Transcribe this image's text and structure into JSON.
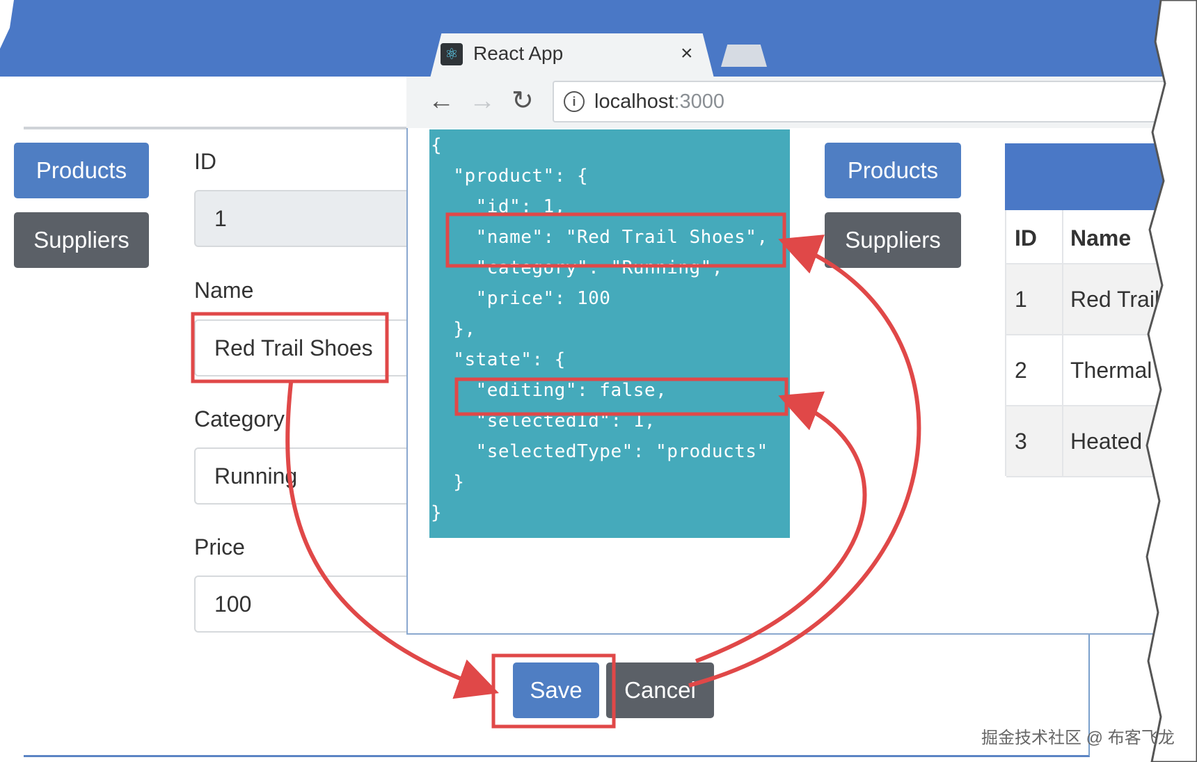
{
  "browser": {
    "tab_title": "React App",
    "tab_close": "×",
    "url_host": "localhost",
    "url_port": ":3000",
    "nav": {
      "back": "←",
      "forward": "→",
      "reload": "↻",
      "info": "i"
    },
    "react_icon": "⚛"
  },
  "left_app": {
    "products_button": "Products",
    "suppliers_button": "Suppliers",
    "form": {
      "id_label": "ID",
      "id_value": "1",
      "name_label": "Name",
      "name_value": "Red Trail Shoes",
      "category_label": "Category",
      "category_value": "Running",
      "price_label": "Price",
      "price_value": "100"
    },
    "save_button": "Save",
    "cancel_button": "Cancel"
  },
  "right_app": {
    "products_button": "Products",
    "suppliers_button": "Suppliers",
    "table": {
      "headers": [
        "ID",
        "Name"
      ],
      "rows": [
        {
          "id": "1",
          "name": "Red Trail"
        },
        {
          "id": "2",
          "name": "Thermal H"
        },
        {
          "id": "3",
          "name": "Heated Gl"
        }
      ]
    }
  },
  "json_lines": [
    "{",
    "  \"product\": {",
    "    \"id\": 1,",
    "    \"name\": \"Red Trail Shoes\",",
    "    \"category\": \"Running\",",
    "    \"price\": 100",
    "  },",
    "  \"state\": {",
    "    \"editing\": false,",
    "    \"selectedId\": 1,",
    "    \"selectedType\": \"products\"",
    "  }",
    "}"
  ],
  "watermark": "掘金技术社区 @ 布客飞龙",
  "colors": {
    "accent_blue": "#4f7ec3",
    "secondary_gray": "#5b6067",
    "json_bg": "#45aabb",
    "highlight_red": "#e04848"
  }
}
